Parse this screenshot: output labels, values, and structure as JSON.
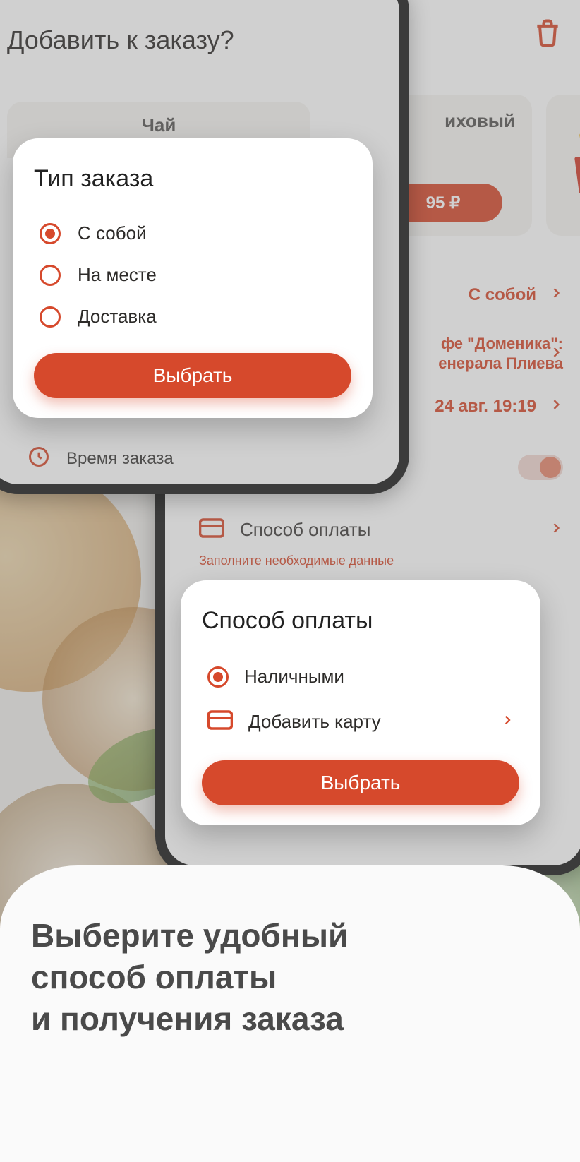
{
  "colors": {
    "accent": "#d6492c"
  },
  "front_phone": {
    "page_title": "Добавить к заказу?",
    "product_card_title": "Чай",
    "bottom_row_label": "Время заказа"
  },
  "back_phone": {
    "product2_name_suffix": "иховый",
    "product2_price": "95 ₽",
    "row_order_type": "С собой",
    "row_location_line1": "фе \"Доменика\":",
    "row_location_line2": "енерала Плиева",
    "row_time": "24 авг. 19:19",
    "pay_row_label": "Способ оплаты",
    "pay_warn": "Заполните необходимые данные"
  },
  "modal_order_type": {
    "title": "Тип заказа",
    "options": [
      "С собой",
      "На месте",
      "Доставка"
    ],
    "button": "Выбрать"
  },
  "modal_payment": {
    "title": "Способ оплаты",
    "option_cash": "Наличными",
    "option_add_card": "Добавить карту",
    "button": "Выбрать"
  },
  "promo": {
    "line1": "Выберите удобный",
    "line2": "способ оплаты",
    "line3": "и получения заказа"
  }
}
